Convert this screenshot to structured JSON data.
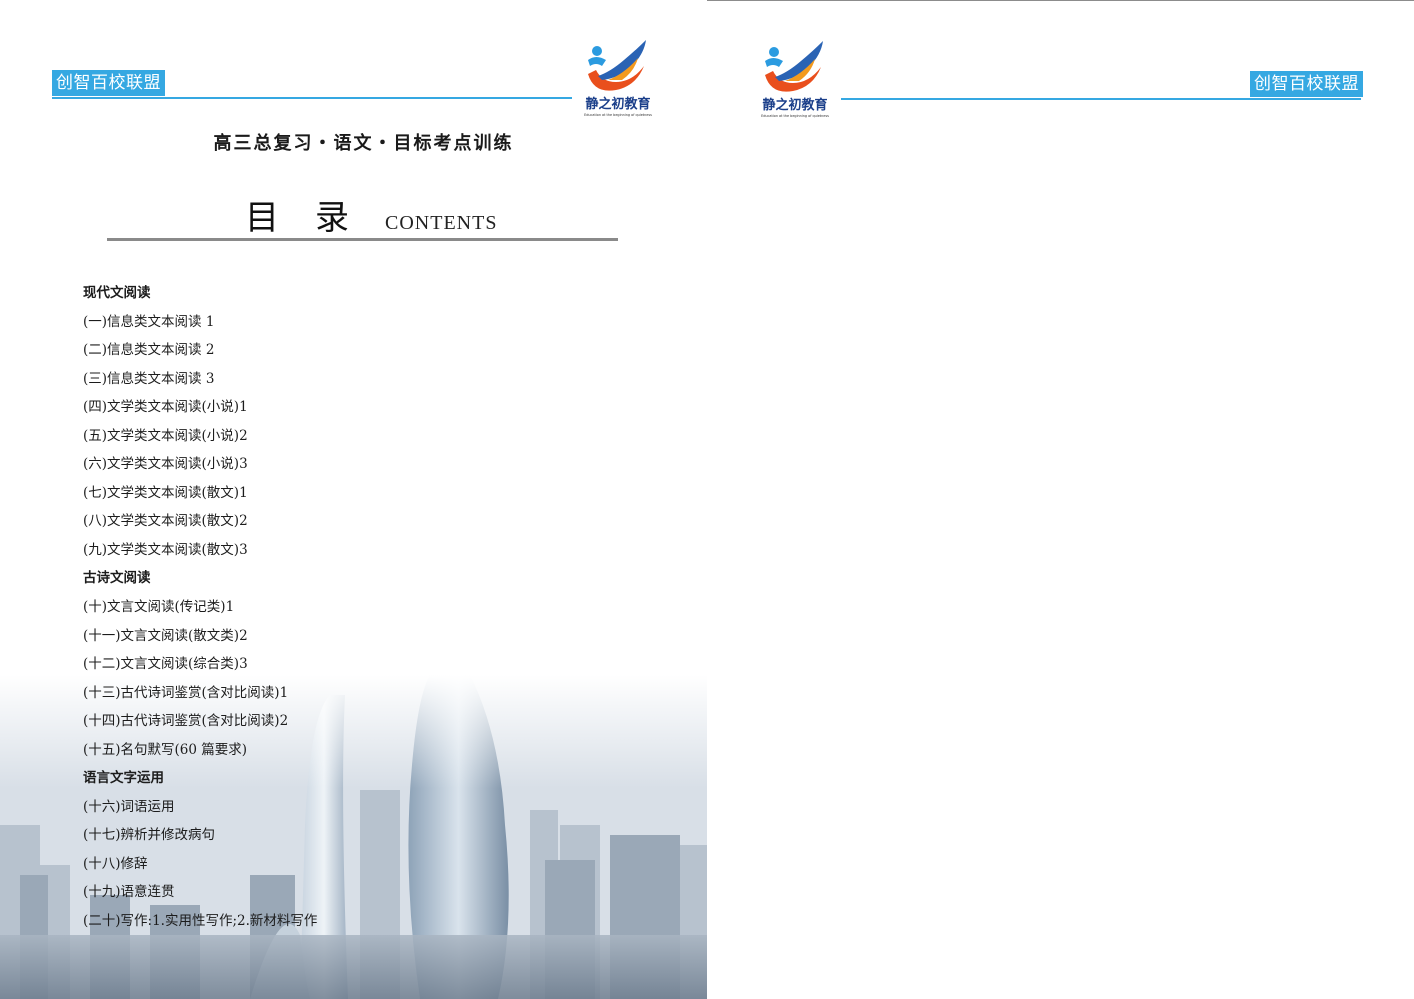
{
  "brand": {
    "badge_text": "创智百校联盟",
    "logo_name": "静之初教育",
    "logo_slogan": "Education at the beginning of quietness",
    "accent_color": "#35a8e2"
  },
  "header": {
    "book_title": "高三总复习・语文・目标考点训练",
    "contents_cn": "目录",
    "contents_en": "CONTENTS"
  },
  "toc": [
    {
      "type": "section",
      "label": "现代文阅读"
    },
    {
      "type": "item",
      "label": "(一)信息类文本阅读 1"
    },
    {
      "type": "item",
      "label": "(二)信息类文本阅读 2"
    },
    {
      "type": "item",
      "label": "(三)信息类文本阅读 3"
    },
    {
      "type": "item",
      "label": "(四)文学类文本阅读(小说)1"
    },
    {
      "type": "item",
      "label": "(五)文学类文本阅读(小说)2"
    },
    {
      "type": "item",
      "label": "(六)文学类文本阅读(小说)3"
    },
    {
      "type": "item",
      "label": "(七)文学类文本阅读(散文)1"
    },
    {
      "type": "item",
      "label": "(八)文学类文本阅读(散文)2"
    },
    {
      "type": "item",
      "label": "(九)文学类文本阅读(散文)3"
    },
    {
      "type": "section",
      "label": "古诗文阅读"
    },
    {
      "type": "item",
      "label": "(十)文言文阅读(传记类)1"
    },
    {
      "type": "item",
      "label": "(十一)文言文阅读(散文类)2"
    },
    {
      "type": "item",
      "label": "(十二)文言文阅读(综合类)3"
    },
    {
      "type": "item",
      "label": "(十三)古代诗词鉴赏(含对比阅读)1"
    },
    {
      "type": "item",
      "label": "(十四)古代诗词鉴赏(含对比阅读)2"
    },
    {
      "type": "item",
      "label": "(十五)名句默写(60 篇要求)"
    },
    {
      "type": "section",
      "label": "语言文字运用"
    },
    {
      "type": "item",
      "label": "(十六)词语运用"
    },
    {
      "type": "item",
      "label": "(十七)辨析并修改病句"
    },
    {
      "type": "item",
      "label": "(十八)修辞"
    },
    {
      "type": "item",
      "label": "(十九)语意连贯"
    },
    {
      "type": "item",
      "label": "(二十)写作:1.实用性写作;2.新材料写作"
    }
  ]
}
